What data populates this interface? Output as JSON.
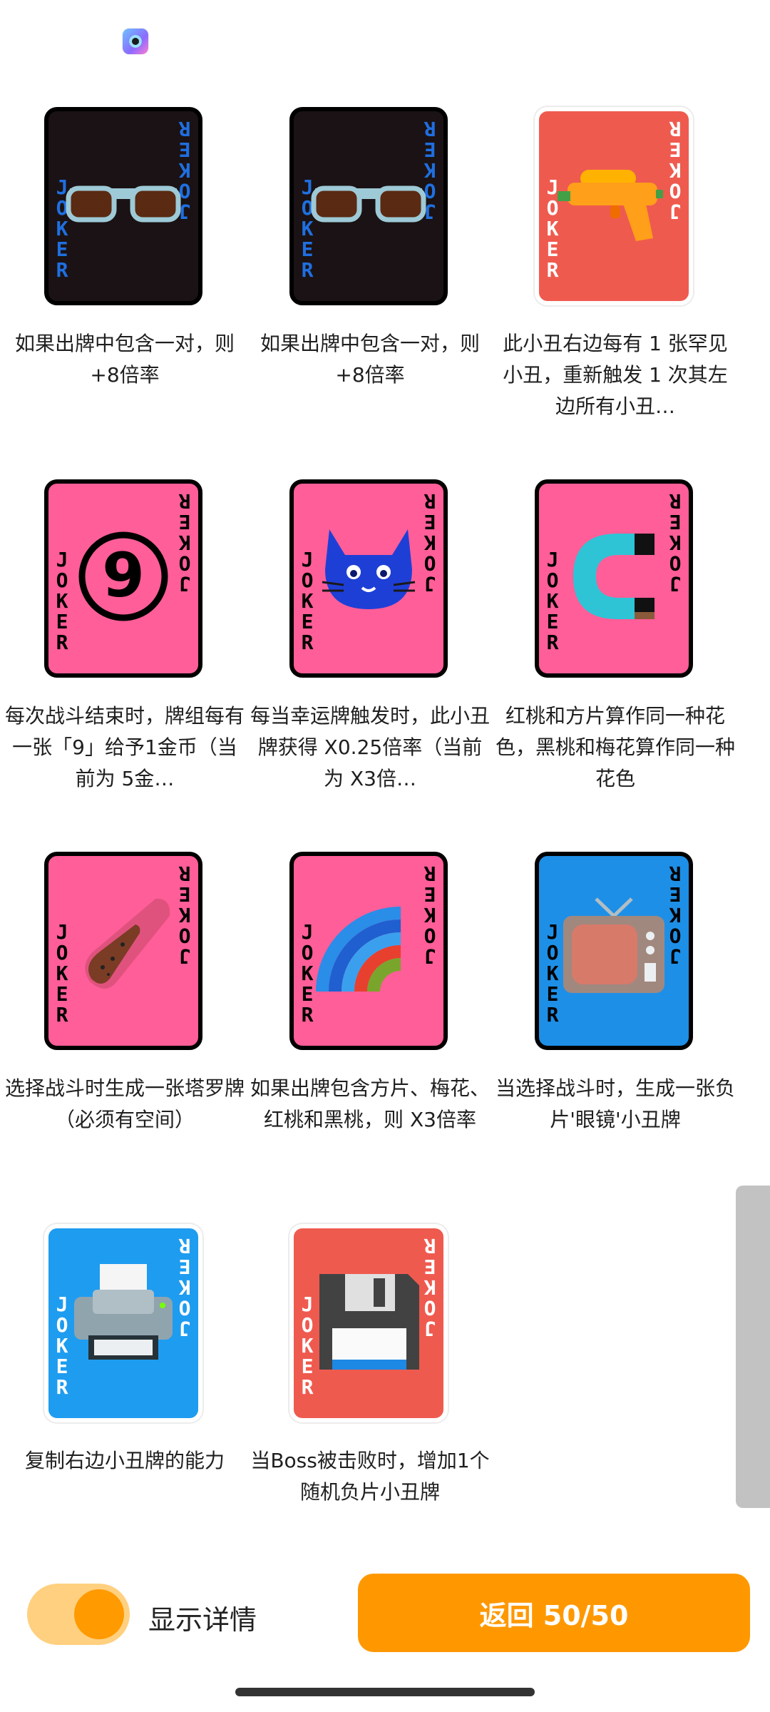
{
  "cards": [
    {
      "joker_text": "JOKER",
      "description": "如果出牌中包含一对，则 +8倍率",
      "icon": "sunglasses-icon",
      "background": "#1a1214",
      "text_color": "#1f6fe0"
    },
    {
      "joker_text": "JOKER",
      "description": "如果出牌中包含一对，则 +8倍率",
      "icon": "sunglasses-icon",
      "background": "#1a1214",
      "text_color": "#1f6fe0"
    },
    {
      "joker_text": "JOKER",
      "description": "此小丑右边每有 1 张罕见小丑，重新触发 1 次其左边所有小丑…",
      "icon": "water-gun-icon",
      "background": "#ef5a4f",
      "text_color": "#ffffff"
    },
    {
      "joker_text": "JOKER",
      "description": "每次战斗结束时，牌组每有一张「9」给予1金币（当前为 5金…",
      "icon": "number-nine-icon",
      "background": "#ff5e98",
      "text_color": "#000000"
    },
    {
      "joker_text": "JOKER",
      "description": "每当幸运牌触发时，此小丑牌获得 X0.25倍率（当前为 X3倍…",
      "icon": "cat-face-icon",
      "background": "#ff5e98",
      "text_color": "#000000"
    },
    {
      "joker_text": "JOKER",
      "description": "红桃和方片算作同一种花色，黑桃和梅花算作同一种花色",
      "icon": "magnet-icon",
      "background": "#ff5e98",
      "text_color": "#000000"
    },
    {
      "joker_text": "JOKER",
      "description": "选择战斗时生成一张塔罗牌（必须有空间）",
      "icon": "comet-icon",
      "background": "#ff5e98",
      "text_color": "#000000"
    },
    {
      "joker_text": "JOKER",
      "description": "如果出牌包含方片、梅花、红桃和黑桃，则 X3倍率",
      "icon": "rainbow-icon",
      "background": "#ff5e98",
      "text_color": "#000000"
    },
    {
      "joker_text": "JOKER",
      "description": "当选择战斗时，生成一张负片'眼镜'小丑牌",
      "icon": "television-icon",
      "background": "#1e8fe6",
      "text_color": "#000000"
    },
    {
      "joker_text": "JOKER",
      "description": "复制右边小丑牌的能力",
      "icon": "printer-icon",
      "background": "#1e9cf0",
      "text_color": "#ffffff"
    },
    {
      "joker_text": "JOKER",
      "description": "当Boss被击败时，增加1个随机负片小丑牌",
      "icon": "floppy-disk-icon",
      "background": "#ef5a4f",
      "text_color": "#ffffff"
    }
  ],
  "footer": {
    "toggle_label": "显示详情",
    "toggle_on": true,
    "back_label": "返回 50/50"
  },
  "colors": {
    "accent": "#ff9800",
    "toggle_track": "#ffd07f"
  }
}
